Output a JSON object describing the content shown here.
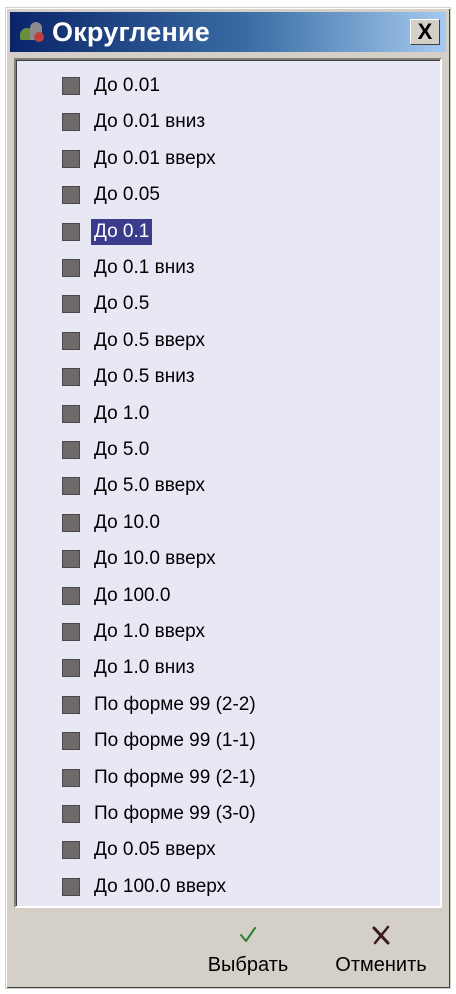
{
  "window": {
    "title": "Округление",
    "close_label": "X"
  },
  "list": {
    "selected_index": 4,
    "items": [
      {
        "label": "До 0.01"
      },
      {
        "label": "До 0.01 вниз"
      },
      {
        "label": "До 0.01 вверх"
      },
      {
        "label": "До 0.05"
      },
      {
        "label": "До 0.1"
      },
      {
        "label": "До 0.1 вниз"
      },
      {
        "label": "До 0.5"
      },
      {
        "label": "До 0.5 вверх"
      },
      {
        "label": "До 0.5 вниз"
      },
      {
        "label": "До 1.0"
      },
      {
        "label": "До 5.0"
      },
      {
        "label": "До 5.0 вверх"
      },
      {
        "label": "До 10.0"
      },
      {
        "label": "До 10.0 вверх"
      },
      {
        "label": "До 100.0"
      },
      {
        "label": "До 1.0 вверх"
      },
      {
        "label": "До 1.0 вниз"
      },
      {
        "label": "По форме 99 (2-2)"
      },
      {
        "label": "По форме 99 (1-1)"
      },
      {
        "label": "По форме 99 (2-1)"
      },
      {
        "label": "По форме 99 (3-0)"
      },
      {
        "label": "До 0.05 вверх"
      },
      {
        "label": "До 100.0 вверх"
      }
    ]
  },
  "footer": {
    "select_label": "Выбрать",
    "select_icon": "checkmark-icon",
    "cancel_label": "Отменить",
    "cancel_icon": "cross-icon"
  },
  "colors": {
    "title_bar_start": "#0a246a",
    "selection": "#3c3c8c",
    "list_bg": "#e8e8f4",
    "check_green": "#2e7d2e",
    "cross_dark": "#3a1a1a"
  }
}
